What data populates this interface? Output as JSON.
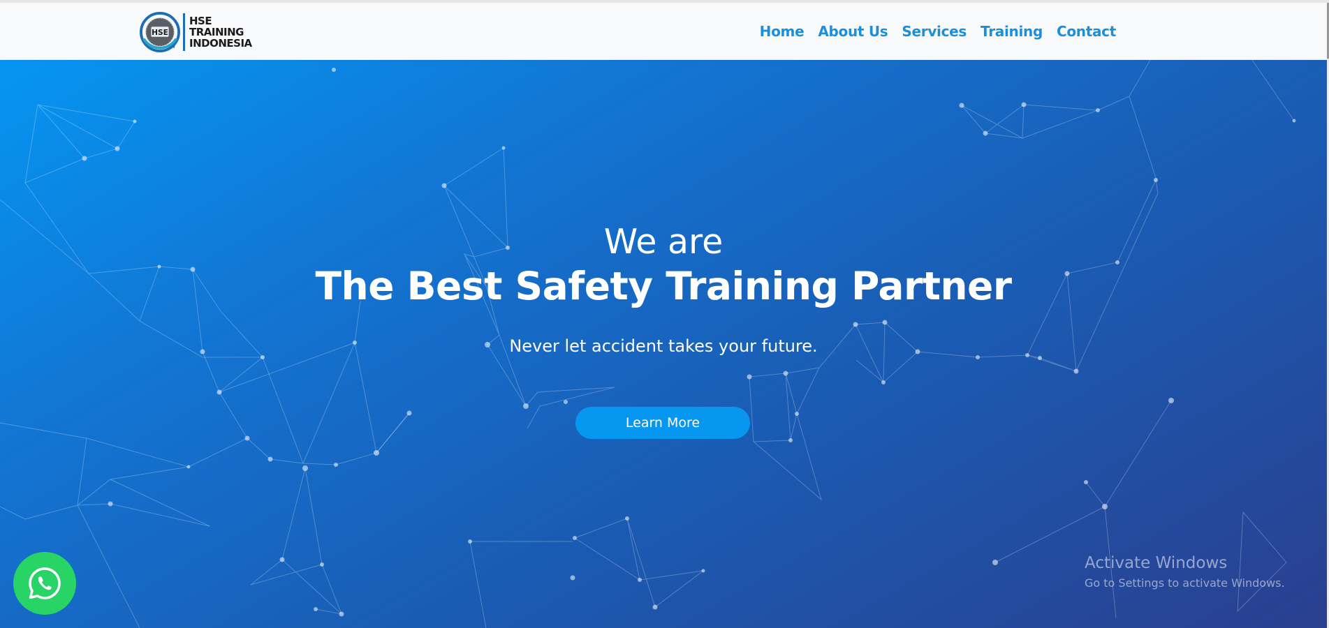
{
  "brand": {
    "name_lines": [
      "HSE",
      "TRAINING",
      "INDONESIA"
    ],
    "emblem_text": "HSE",
    "colors": {
      "ring": "#1c6cb8",
      "teal": "#22a7c5"
    }
  },
  "nav": {
    "items": [
      {
        "label": "Home"
      },
      {
        "label": "About Us"
      },
      {
        "label": "Services"
      },
      {
        "label": "Training"
      },
      {
        "label": "Contact"
      }
    ],
    "color": "#1a8fdc"
  },
  "hero": {
    "intro": "We are",
    "headline": "The Best Safety Training Partner",
    "tagline": "Never let accident takes your future.",
    "cta_label": "Learn More",
    "gradient": [
      "#0596f2",
      "#1a5cb4",
      "#2a3f8f"
    ]
  },
  "whatsapp": {
    "icon": "whatsapp-icon",
    "color": "#28d465"
  },
  "windows_watermark": {
    "title": "Activate Windows",
    "subtitle": "Go to Settings to activate Windows."
  }
}
